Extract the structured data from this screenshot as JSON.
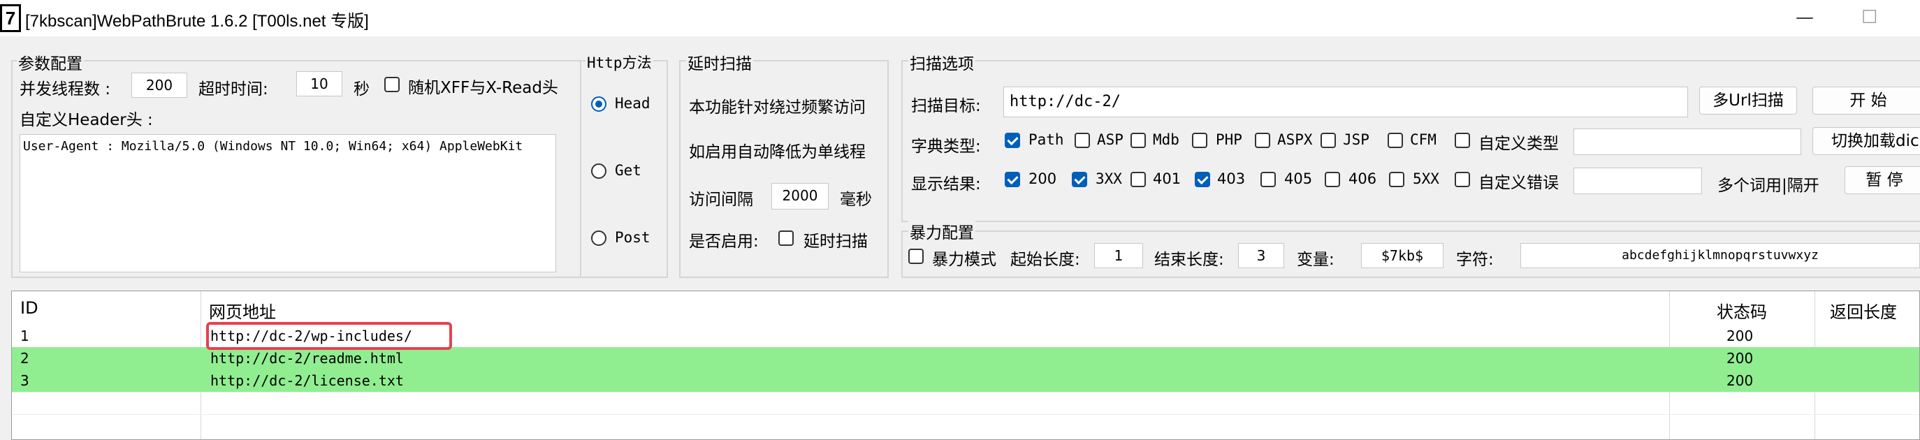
{
  "window": {
    "icon_text": "7",
    "title": "[7kbscan]WebPathBrute 1.6.2 [T00ls.net 专版]",
    "minimize": "—",
    "maximize": "☐"
  },
  "params": {
    "group_label": "参数配置",
    "threads_label": "并发线程数 :",
    "threads_value": "200",
    "timeout_label": "超时时间:",
    "timeout_value": "10",
    "timeout_unit": "秒",
    "random_xff_label": "随机XFF与X-Read头",
    "header_label": "自定义Header头 :",
    "header_value": "User-Agent : Mozilla/5.0 (Windows NT 10.0; Win64; x64) AppleWebKit"
  },
  "http": {
    "group_label": "Http方法",
    "options": [
      "Head",
      "Get",
      "Post"
    ],
    "selected": "Head"
  },
  "delay": {
    "group_label": "延时扫描",
    "desc1": "本功能针对绕过频繁访问",
    "desc2": "如启用自动降低为单线程",
    "interval_label": "访问间隔",
    "interval_value": "2000",
    "interval_unit": "毫秒",
    "enable_label": "是否启用:",
    "enable_cb_label": "延时扫描"
  },
  "scan": {
    "group_label": "扫描选项",
    "target_label": "扫描目标:",
    "target_value": "http://dc-2/",
    "multi_url_button": "多Url扫描",
    "start_button": "开 始",
    "dict_label": "字典类型:",
    "dict_types": [
      {
        "label": "Path",
        "checked": true
      },
      {
        "label": "ASP",
        "checked": false
      },
      {
        "label": "Mdb",
        "checked": false
      },
      {
        "label": "PHP",
        "checked": false
      },
      {
        "label": "ASPX",
        "checked": false
      },
      {
        "label": "JSP",
        "checked": false
      },
      {
        "label": "CFM",
        "checked": false
      }
    ],
    "custom_type_label": "自定义类型",
    "switch_dict_button": "切换加载dic",
    "result_label": "显示结果:",
    "result_codes": [
      {
        "label": "200",
        "checked": true
      },
      {
        "label": "3XX",
        "checked": true
      },
      {
        "label": "401",
        "checked": false
      },
      {
        "label": "403",
        "checked": true
      },
      {
        "label": "405",
        "checked": false
      },
      {
        "label": "406",
        "checked": false
      },
      {
        "label": "5XX",
        "checked": false
      }
    ],
    "custom_error_label": "自定义错误",
    "multi_word_label": "多个词用|隔开",
    "pause_button": "暂 停"
  },
  "brute": {
    "group_label": "暴力配置",
    "mode_label": "暴力模式",
    "start_len_label": "起始长度:",
    "start_len_value": "1",
    "end_len_label": "结束长度:",
    "end_len_value": "3",
    "var_label": "变量:",
    "var_value": "$7kb$",
    "chars_label": "字符:",
    "chars_value": "abcdefghijklmnopqrstuvwxyz"
  },
  "results": {
    "columns": [
      "ID",
      "网页地址",
      "状态码",
      "返回长度"
    ],
    "rows": [
      {
        "id": "1",
        "url": "http://dc-2/wp-includes/",
        "status": "200",
        "length": "",
        "highlight": false,
        "selected": true
      },
      {
        "id": "2",
        "url": "http://dc-2/readme.html",
        "status": "200",
        "length": "",
        "highlight": true,
        "selected": false
      },
      {
        "id": "3",
        "url": "http://dc-2/license.txt",
        "status": "200",
        "length": "",
        "highlight": true,
        "selected": false
      }
    ]
  },
  "colors": {
    "highlight_row": "#90ee90",
    "selection_box": "#e8404f",
    "checkbox_accent": "#005fb8"
  }
}
